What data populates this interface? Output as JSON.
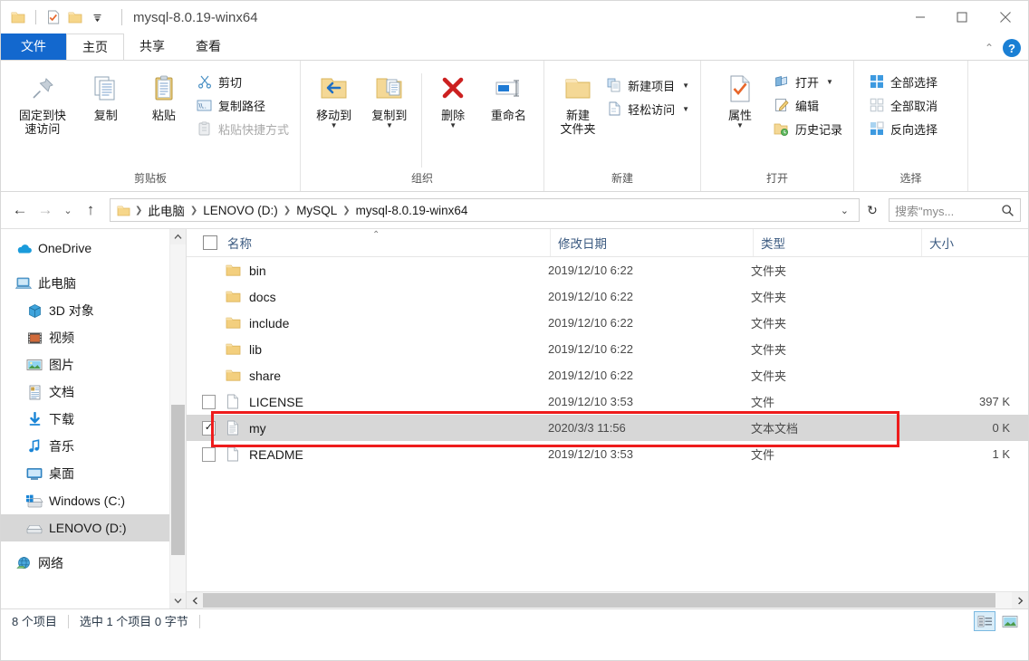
{
  "window": {
    "title": "mysql-8.0.19-winx64",
    "quick_access": [
      {
        "name": "folder-icon",
        "label": ""
      },
      {
        "name": "properties-icon",
        "label": ""
      },
      {
        "name": "new-folder-icon",
        "label": ""
      },
      {
        "name": "customize-qat-dropdown",
        "label": "▼"
      }
    ],
    "controls": {
      "minimize": "—",
      "maximize": "☐",
      "close": "✕"
    }
  },
  "tabs": {
    "file": "文件",
    "items": [
      {
        "label": "主页",
        "active": true
      },
      {
        "label": "共享",
        "active": false
      },
      {
        "label": "查看",
        "active": false
      }
    ],
    "collapse_ribbon": "⌃",
    "help": "?"
  },
  "ribbon": {
    "groups": [
      {
        "label": "剪贴板",
        "big_buttons": [
          {
            "label": "固定到快\n速访问",
            "icon": "pin-icon",
            "enabled": true
          },
          {
            "label": "复制",
            "icon": "copy-icon",
            "enabled": true
          },
          {
            "label": "粘贴",
            "icon": "paste-icon",
            "enabled": true
          }
        ],
        "small_buttons": [
          {
            "label": "剪切",
            "icon": "scissors-icon",
            "enabled": true
          },
          {
            "label": "复制路径",
            "icon": "copy-path-icon",
            "enabled": true
          },
          {
            "label": "粘贴快捷方式",
            "icon": "paste-shortcut-icon",
            "enabled": false
          }
        ]
      },
      {
        "label": "组织",
        "big_buttons": [
          {
            "label": "移动到",
            "icon": "move-to-icon",
            "enabled": true,
            "caret": true
          },
          {
            "label": "复制到",
            "icon": "copy-to-icon",
            "enabled": true,
            "caret": true
          },
          {
            "label": "删除",
            "icon": "delete-icon",
            "enabled": true,
            "caret": true
          },
          {
            "label": "重命名",
            "icon": "rename-icon",
            "enabled": true,
            "caret": false
          }
        ],
        "small_buttons": []
      },
      {
        "label": "新建",
        "big_buttons": [
          {
            "label": "新建\n文件夹",
            "icon": "new-folder-icon",
            "enabled": true
          }
        ],
        "small_buttons": [
          {
            "label": "新建项目",
            "icon": "new-item-icon",
            "enabled": true,
            "caret": true
          },
          {
            "label": "轻松访问",
            "icon": "easy-access-icon",
            "enabled": true,
            "caret": true
          }
        ]
      },
      {
        "label": "打开",
        "big_buttons": [
          {
            "label": "属性",
            "icon": "properties-icon",
            "enabled": true,
            "caret": true
          }
        ],
        "small_buttons": [
          {
            "label": "打开",
            "icon": "open-icon",
            "enabled": true,
            "caret": true
          },
          {
            "label": "编辑",
            "icon": "edit-icon",
            "enabled": true
          },
          {
            "label": "历史记录",
            "icon": "history-icon",
            "enabled": true
          }
        ]
      },
      {
        "label": "选择",
        "big_buttons": [],
        "small_buttons": [
          {
            "label": "全部选择",
            "icon": "select-all-icon",
            "enabled": true
          },
          {
            "label": "全部取消",
            "icon": "select-none-icon",
            "enabled": false
          },
          {
            "label": "反向选择",
            "icon": "invert-selection-icon",
            "enabled": true
          }
        ]
      }
    ]
  },
  "address": {
    "back": "←",
    "forward": "→",
    "recent": "⌄",
    "up": "↑",
    "breadcrumbs": [
      "此电脑",
      "LENOVO (D:)",
      "MySQL",
      "mysql-8.0.19-winx64"
    ],
    "dropdown": "⌄",
    "refresh": "↻",
    "search_placeholder": "搜索\"mys...",
    "search_value": ""
  },
  "sidebar": {
    "items": [
      {
        "label": "OneDrive",
        "icon": "onedrive-cloud-icon",
        "level": 0,
        "selected": false,
        "gap_before": false
      },
      {
        "label": "此电脑",
        "icon": "this-pc-icon",
        "level": 0,
        "selected": false,
        "gap_before": true
      },
      {
        "label": "3D 对象",
        "icon": "3d-objects-icon",
        "level": 1,
        "selected": false,
        "gap_before": false
      },
      {
        "label": "视频",
        "icon": "videos-icon",
        "level": 1,
        "selected": false,
        "gap_before": false
      },
      {
        "label": "图片",
        "icon": "pictures-icon",
        "level": 1,
        "selected": false,
        "gap_before": false
      },
      {
        "label": "文档",
        "icon": "documents-icon",
        "level": 1,
        "selected": false,
        "gap_before": false
      },
      {
        "label": "下载",
        "icon": "downloads-icon",
        "level": 1,
        "selected": false,
        "gap_before": false
      },
      {
        "label": "音乐",
        "icon": "music-icon",
        "level": 1,
        "selected": false,
        "gap_before": false
      },
      {
        "label": "桌面",
        "icon": "desktop-icon",
        "level": 1,
        "selected": false,
        "gap_before": false
      },
      {
        "label": "Windows (C:)",
        "icon": "drive-windows-icon",
        "level": 1,
        "selected": false,
        "gap_before": false
      },
      {
        "label": "LENOVO (D:)",
        "icon": "drive-icon",
        "level": 1,
        "selected": true,
        "gap_before": false
      },
      {
        "label": "网络",
        "icon": "network-icon",
        "level": 0,
        "selected": false,
        "gap_before": true
      }
    ]
  },
  "filelist": {
    "columns": [
      {
        "key": "name",
        "label": "名称"
      },
      {
        "key": "date",
        "label": "修改日期"
      },
      {
        "key": "type",
        "label": "类型"
      },
      {
        "key": "size",
        "label": "大小"
      }
    ],
    "sort_indicator": "⌃",
    "rows": [
      {
        "name": "bin",
        "date": "2019/12/10 6:22",
        "type": "文件夹",
        "size": "",
        "icon": "folder-icon",
        "checked": false,
        "selected": false,
        "show_check": false
      },
      {
        "name": "docs",
        "date": "2019/12/10 6:22",
        "type": "文件夹",
        "size": "",
        "icon": "folder-icon",
        "checked": false,
        "selected": false,
        "show_check": false
      },
      {
        "name": "include",
        "date": "2019/12/10 6:22",
        "type": "文件夹",
        "size": "",
        "icon": "folder-icon",
        "checked": false,
        "selected": false,
        "show_check": false
      },
      {
        "name": "lib",
        "date": "2019/12/10 6:22",
        "type": "文件夹",
        "size": "",
        "icon": "folder-icon",
        "checked": false,
        "selected": false,
        "show_check": false
      },
      {
        "name": "share",
        "date": "2019/12/10 6:22",
        "type": "文件夹",
        "size": "",
        "icon": "folder-icon",
        "checked": false,
        "selected": false,
        "show_check": false
      },
      {
        "name": "LICENSE",
        "date": "2019/12/10 3:53",
        "type": "文件",
        "size": "397 K",
        "icon": "file-icon",
        "checked": false,
        "selected": false,
        "show_check": true
      },
      {
        "name": "my",
        "date": "2020/3/3 11:56",
        "type": "文本文档",
        "size": "0 K",
        "icon": "text-file-icon",
        "checked": true,
        "selected": true,
        "show_check": true
      },
      {
        "name": "README",
        "date": "2019/12/10 3:53",
        "type": "文件",
        "size": "1 K",
        "icon": "file-icon",
        "checked": false,
        "selected": false,
        "show_check": true
      }
    ],
    "highlight_color": "#ee1c1c",
    "selection_color": "#d7d7d7"
  },
  "status": {
    "count": "8 个项目",
    "selection": "选中 1 个项目  0 字节",
    "views": [
      {
        "name": "details-view-button",
        "active": true
      },
      {
        "name": "large-icons-view-button",
        "active": false
      }
    ]
  }
}
